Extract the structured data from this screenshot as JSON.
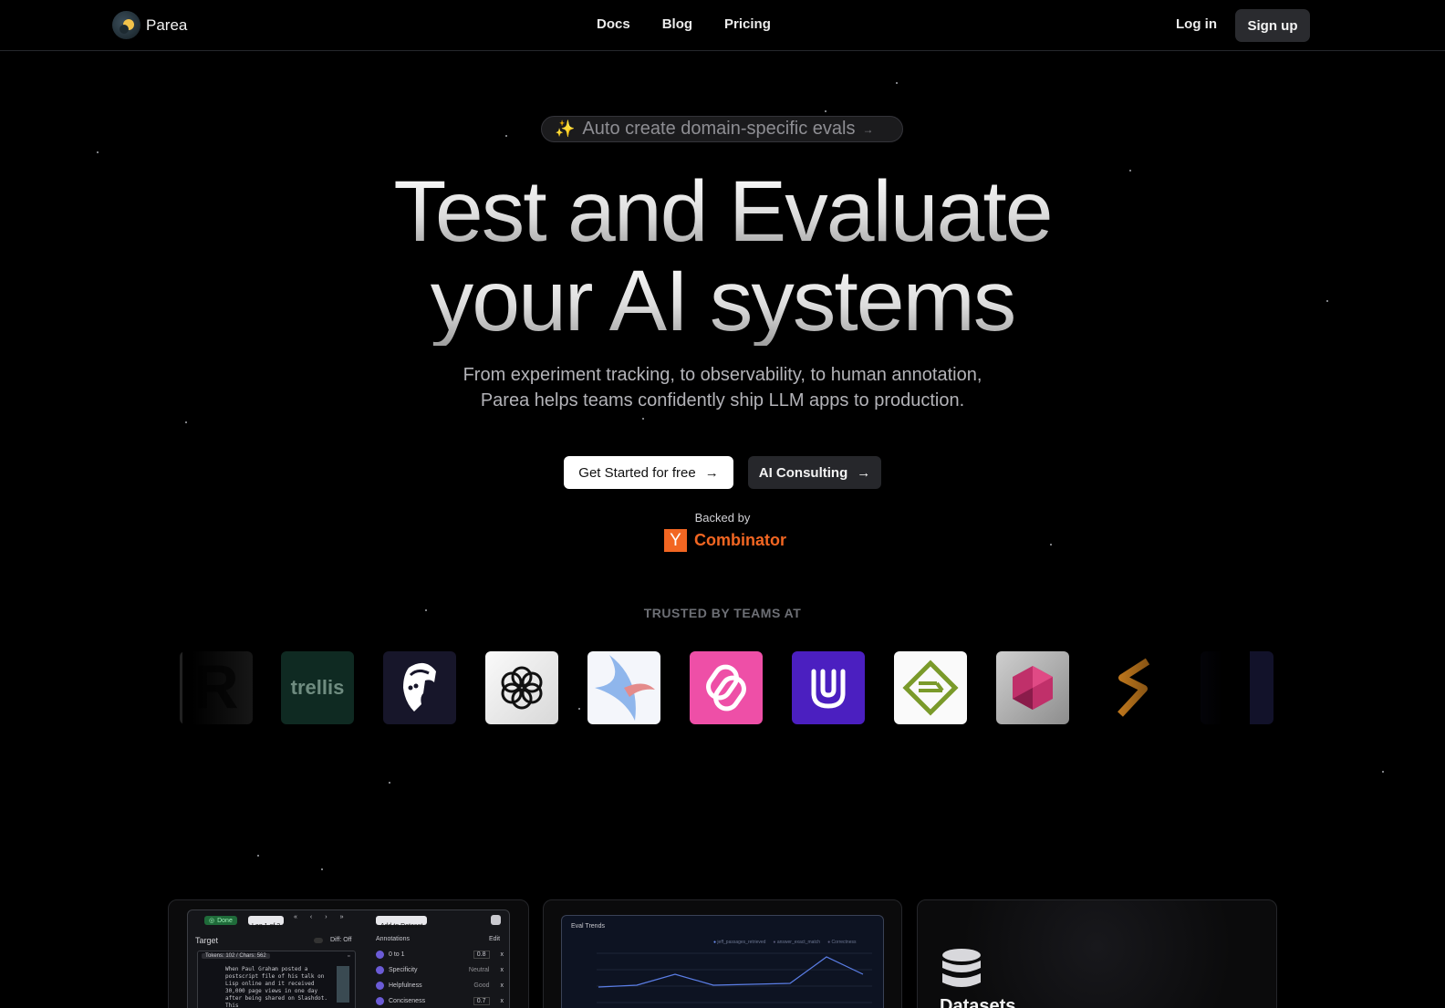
{
  "nav": {
    "brand": "Parea",
    "links": [
      "Docs",
      "Blog",
      "Pricing"
    ],
    "login": "Log in",
    "signup": "Sign up"
  },
  "hero": {
    "pill_text": "Auto create domain-specific evals",
    "title_line1": "Test and Evaluate",
    "title_line2": "your AI systems",
    "subtitle_line1": "From experiment tracking, to observability, to human annotation,",
    "subtitle_line2": "Parea helps teams confidently ship LLM apps to production.",
    "cta_primary": "Get Started for free",
    "cta_secondary": "AI Consulting",
    "backed_by": "Backed by",
    "yc_letter": "Y",
    "yc_text": "Combinator"
  },
  "trusted": {
    "heading": "TRUSTED BY TEAMS AT",
    "logo_text_trellis": "trellis"
  },
  "cards": {
    "annotation": {
      "status": "Done",
      "log_label": "Log 1 of 2",
      "add_dataset": "Add to Dataset",
      "target_label": "Target",
      "diff_label": "Diff: Off",
      "tokens_label": "Tokens: 102 / Chars: 562",
      "snippet": "When Paul Graham posted a postscript file of his talk on Lisp online and it received 30,000 page views in one day after being shared on Slashdot. This",
      "annotations_label": "Annotations",
      "edit_label": "Edit",
      "items": [
        {
          "label": "0 to 1",
          "value": "0.8"
        },
        {
          "label": "Specificity",
          "value": "Neutral"
        },
        {
          "label": "Helpfulness",
          "value": "Good"
        },
        {
          "label": "Conciseness",
          "value": "0.7"
        }
      ]
    },
    "trends": {
      "title": "Eval Trends",
      "legend": [
        "jeff_passages_retrieved",
        "answer_exact_match",
        "Correctness"
      ]
    },
    "datasets": {
      "title": "Datasets"
    }
  }
}
